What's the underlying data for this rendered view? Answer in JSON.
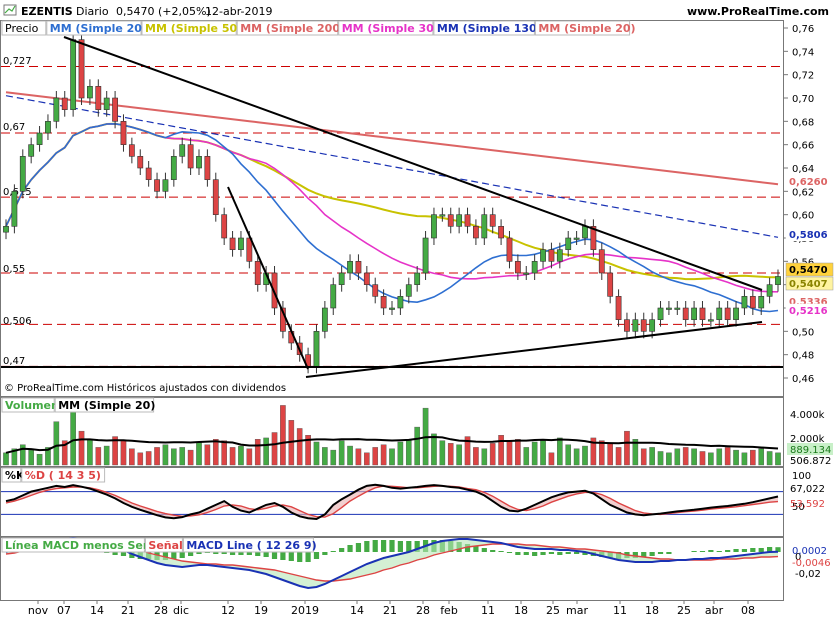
{
  "header": {
    "symbol": "EZENTIS",
    "period": "Diario",
    "price_change": "0,5470 (+2,05%)",
    "date": "12-abr-2019",
    "site": "www.ProRealTime.com"
  },
  "colors": {
    "mm20": "#2e6fd1",
    "mm50": "#c8c200",
    "mm200": "#dc6464",
    "mm30": "#e633c8",
    "mm130": "#1a32b4",
    "up": "#44aa44",
    "down": "#dd4444",
    "trend": "#000000",
    "level": "#cc0000"
  },
  "price_panel": {
    "legend": [
      {
        "label": "Precio",
        "color": "#000000"
      },
      {
        "label": "MM (Simple 20)",
        "color": "#2e6fd1"
      },
      {
        "label": "MM (Simple 50)",
        "color": "#c8c200"
      },
      {
        "label": "MM (Simple 200)",
        "color": "#dc6464"
      },
      {
        "label": "MM (Simple 30)",
        "color": "#e633c8"
      },
      {
        "label": "MM (Simple 130)",
        "color": "#1a32b4"
      },
      {
        "label": "MM (Simple 20)",
        "color": "#dc6464"
      }
    ],
    "footer": "© ProRealTime.com  Históricos ajustados con dividendos",
    "level_labels": [
      "0,727",
      "0,67",
      "0,615",
      "0,55",
      "0,506",
      "0,47"
    ],
    "tag_labels": [
      {
        "text": "0,6260",
        "color": "#dc6464",
        "bg": "#ffffff"
      },
      {
        "text": "0,5806",
        "color": "#1a32b4",
        "bg": "#ffffff"
      },
      {
        "text": "0,5470",
        "color": "#000000",
        "bg": "#ffd23c"
      },
      {
        "text": "0,5407",
        "color": "#8a8400",
        "bg": "#fff4a0"
      },
      {
        "text": "0,5336",
        "color": "#dc6464",
        "bg": "#ffffff"
      },
      {
        "text": "0,5216",
        "color": "#e633c8",
        "bg": "#ffffff"
      }
    ]
  },
  "volume_panel": {
    "legend": [
      {
        "label": "Volumen",
        "color": "#44aa44"
      },
      {
        "label": "MM (Simple 20)",
        "color": "#000000"
      }
    ],
    "axis": [
      "4.000k",
      "2.000k"
    ],
    "tags": [
      "889.134",
      "506.872"
    ]
  },
  "stoch_panel": {
    "legend": [
      {
        "label": "%K",
        "color": "#000000"
      },
      {
        "label": "%D ( 14 3 5)",
        "color": "#dd4444"
      }
    ],
    "axis": [
      "100",
      "50"
    ],
    "tags": [
      "67,022",
      "53,592"
    ]
  },
  "macd_panel": {
    "legend": [
      {
        "label": "Línea MACD menos Señal",
        "color": "#44aa44"
      },
      {
        "label": "Señal",
        "color": "#dd4444"
      },
      {
        "label": "MACD Line ( 12 26 9)",
        "color": "#1a32b4"
      }
    ],
    "axis": [
      "0",
      "-0,02"
    ],
    "tags": [
      "0,0002",
      "-0,0046"
    ]
  },
  "x_axis": [
    "nov",
    "07",
    "14",
    "21",
    "28",
    "dic",
    "12",
    "19",
    "2019",
    "14",
    "21",
    "28",
    "feb",
    "11",
    "18",
    "25",
    "mar",
    "11",
    "18",
    "25",
    "abr",
    "08"
  ],
  "chart_data": {
    "type": "candlestick",
    "y_axis_ticks": [
      0.76,
      0.74,
      0.72,
      0.7,
      0.68,
      0.66,
      0.64,
      0.62,
      0.6,
      0.58,
      0.56,
      0.54,
      0.52,
      0.5,
      0.48,
      0.46
    ],
    "ylim": [
      0.455,
      0.765
    ],
    "levels": [
      0.727,
      0.67,
      0.615,
      0.55,
      0.506,
      0.47
    ],
    "last_price": 0.547,
    "sma20_last": 0.5216,
    "sma50_last": 0.5407,
    "sma130_last": 0.5806,
    "sma200_last": 0.626,
    "close": [
      0.59,
      0.62,
      0.65,
      0.66,
      0.67,
      0.68,
      0.7,
      0.69,
      0.75,
      0.7,
      0.71,
      0.69,
      0.7,
      0.68,
      0.66,
      0.65,
      0.64,
      0.63,
      0.62,
      0.63,
      0.65,
      0.66,
      0.64,
      0.65,
      0.63,
      0.6,
      0.58,
      0.57,
      0.58,
      0.56,
      0.54,
      0.55,
      0.52,
      0.5,
      0.49,
      0.48,
      0.47,
      0.5,
      0.52,
      0.54,
      0.55,
      0.56,
      0.55,
      0.54,
      0.53,
      0.52,
      0.52,
      0.53,
      0.54,
      0.55,
      0.58,
      0.6,
      0.6,
      0.59,
      0.6,
      0.59,
      0.58,
      0.6,
      0.59,
      0.58,
      0.56,
      0.55,
      0.55,
      0.56,
      0.57,
      0.56,
      0.57,
      0.58,
      0.58,
      0.59,
      0.57,
      0.55,
      0.53,
      0.51,
      0.5,
      0.51,
      0.5,
      0.51,
      0.52,
      0.52,
      0.52,
      0.51,
      0.52,
      0.51,
      0.51,
      0.52,
      0.51,
      0.52,
      0.53,
      0.52,
      0.53,
      0.54,
      0.547
    ],
    "volume_k": [
      900,
      1200,
      1500,
      1100,
      800,
      1300,
      3200,
      1800,
      4600,
      2500,
      1900,
      1300,
      1400,
      2100,
      1800,
      1200,
      900,
      1000,
      1300,
      1500,
      1200,
      1300,
      1100,
      1700,
      1500,
      1900,
      1800,
      1300,
      1400,
      1200,
      1900,
      2000,
      2400,
      4400,
      3300,
      2700,
      2200,
      1700,
      1300,
      1100,
      1800,
      1400,
      1200,
      900,
      1300,
      1500,
      1200,
      1700,
      1900,
      2800,
      4200,
      2300,
      1800,
      1600,
      1500,
      2100,
      1300,
      1200,
      1600,
      2200,
      1800,
      1900,
      1300,
      1700,
      1800,
      900,
      2000,
      1500,
      1200,
      1400,
      2000,
      1800,
      1600,
      1300,
      2500,
      1900,
      1200,
      1300,
      1000,
      900,
      1200,
      1300,
      1200,
      1000,
      900,
      1200,
      1300,
      1100,
      900,
      1100,
      1200,
      1000,
      900
    ],
    "stoch_k": [
      55,
      60,
      70,
      80,
      85,
      90,
      95,
      92,
      97,
      93,
      88,
      80,
      72,
      62,
      50,
      40,
      32,
      25,
      18,
      12,
      10,
      13,
      20,
      25,
      35,
      45,
      55,
      40,
      30,
      25,
      35,
      45,
      50,
      40,
      25,
      15,
      10,
      8,
      20,
      45,
      60,
      72,
      85,
      95,
      98,
      95,
      90,
      88,
      90,
      92,
      95,
      97,
      95,
      92,
      90,
      85,
      80,
      70,
      55,
      40,
      30,
      28,
      35,
      45,
      55,
      65,
      72,
      78,
      80,
      82,
      75,
      60,
      45,
      35,
      25,
      20,
      18,
      20,
      22,
      25,
      28,
      30,
      32,
      35,
      38,
      40,
      42,
      45,
      48,
      52,
      57,
      62,
      67
    ],
    "stoch_d": [
      50,
      55,
      62,
      70,
      78,
      84,
      88,
      90,
      92,
      92,
      90,
      85,
      78,
      70,
      60,
      50,
      42,
      35,
      28,
      22,
      18,
      15,
      16,
      19,
      25,
      33,
      42,
      45,
      42,
      35,
      32,
      36,
      42,
      45,
      40,
      30,
      20,
      14,
      13,
      22,
      38,
      55,
      68,
      80,
      90,
      95,
      94,
      92,
      90,
      90,
      92,
      94,
      95,
      94,
      92,
      88,
      85,
      78,
      68,
      55,
      42,
      33,
      30,
      35,
      42,
      52,
      60,
      68,
      74,
      78,
      78,
      72,
      62,
      50,
      40,
      30,
      24,
      21,
      20,
      22,
      25,
      27,
      29,
      31,
      34,
      36,
      38,
      40,
      43,
      46,
      49,
      52,
      53.6
    ],
    "macd_line": [
      0,
      0.002,
      0.004,
      0.006,
      0.008,
      0.01,
      0.012,
      0.013,
      0.014,
      0.013,
      0.012,
      0.01,
      0.008,
      0.005,
      0.002,
      -0.002,
      -0.005,
      -0.008,
      -0.011,
      -0.013,
      -0.014,
      -0.015,
      -0.014,
      -0.013,
      -0.013,
      -0.014,
      -0.015,
      -0.016,
      -0.017,
      -0.018,
      -0.02,
      -0.022,
      -0.025,
      -0.028,
      -0.031,
      -0.034,
      -0.036,
      -0.035,
      -0.032,
      -0.028,
      -0.024,
      -0.02,
      -0.016,
      -0.012,
      -0.009,
      -0.006,
      -0.004,
      -0.002,
      0,
      0.003,
      0.006,
      0.009,
      0.011,
      0.012,
      0.013,
      0.013,
      0.012,
      0.011,
      0.01,
      0.009,
      0.007,
      0.005,
      0.004,
      0.003,
      0.003,
      0.003,
      0.002,
      0.002,
      0.001,
      0,
      -0.002,
      -0.004,
      -0.006,
      -0.008,
      -0.009,
      -0.01,
      -0.01,
      -0.01,
      -0.009,
      -0.009,
      -0.008,
      -0.008,
      -0.007,
      -0.007,
      -0.006,
      -0.006,
      -0.005,
      -0.004,
      -0.003,
      -0.002,
      -0.001,
      0,
      0.0002
    ],
    "macd_signal": [
      -0.002,
      -0.001,
      0.001,
      0.002,
      0.004,
      0.005,
      0.007,
      0.008,
      0.009,
      0.01,
      0.01,
      0.01,
      0.009,
      0.008,
      0.006,
      0.004,
      0.002,
      -0.001,
      -0.003,
      -0.005,
      -0.007,
      -0.009,
      -0.01,
      -0.011,
      -0.012,
      -0.012,
      -0.013,
      -0.013,
      -0.014,
      -0.015,
      -0.016,
      -0.017,
      -0.018,
      -0.02,
      -0.022,
      -0.024,
      -0.026,
      -0.028,
      -0.029,
      -0.029,
      -0.028,
      -0.027,
      -0.025,
      -0.023,
      -0.021,
      -0.018,
      -0.016,
      -0.013,
      -0.011,
      -0.008,
      -0.006,
      -0.003,
      -0.001,
      0.001,
      0.003,
      0.005,
      0.006,
      0.007,
      0.008,
      0.008,
      0.008,
      0.008,
      0.007,
      0.007,
      0.006,
      0.005,
      0.005,
      0.004,
      0.003,
      0.003,
      0.002,
      0.001,
      0,
      -0.001,
      -0.003,
      -0.004,
      -0.005,
      -0.006,
      -0.007,
      -0.007,
      -0.008,
      -0.008,
      -0.008,
      -0.008,
      -0.008,
      -0.007,
      -0.007,
      -0.007,
      -0.006,
      -0.006,
      -0.005,
      -0.005,
      -0.0046
    ]
  }
}
